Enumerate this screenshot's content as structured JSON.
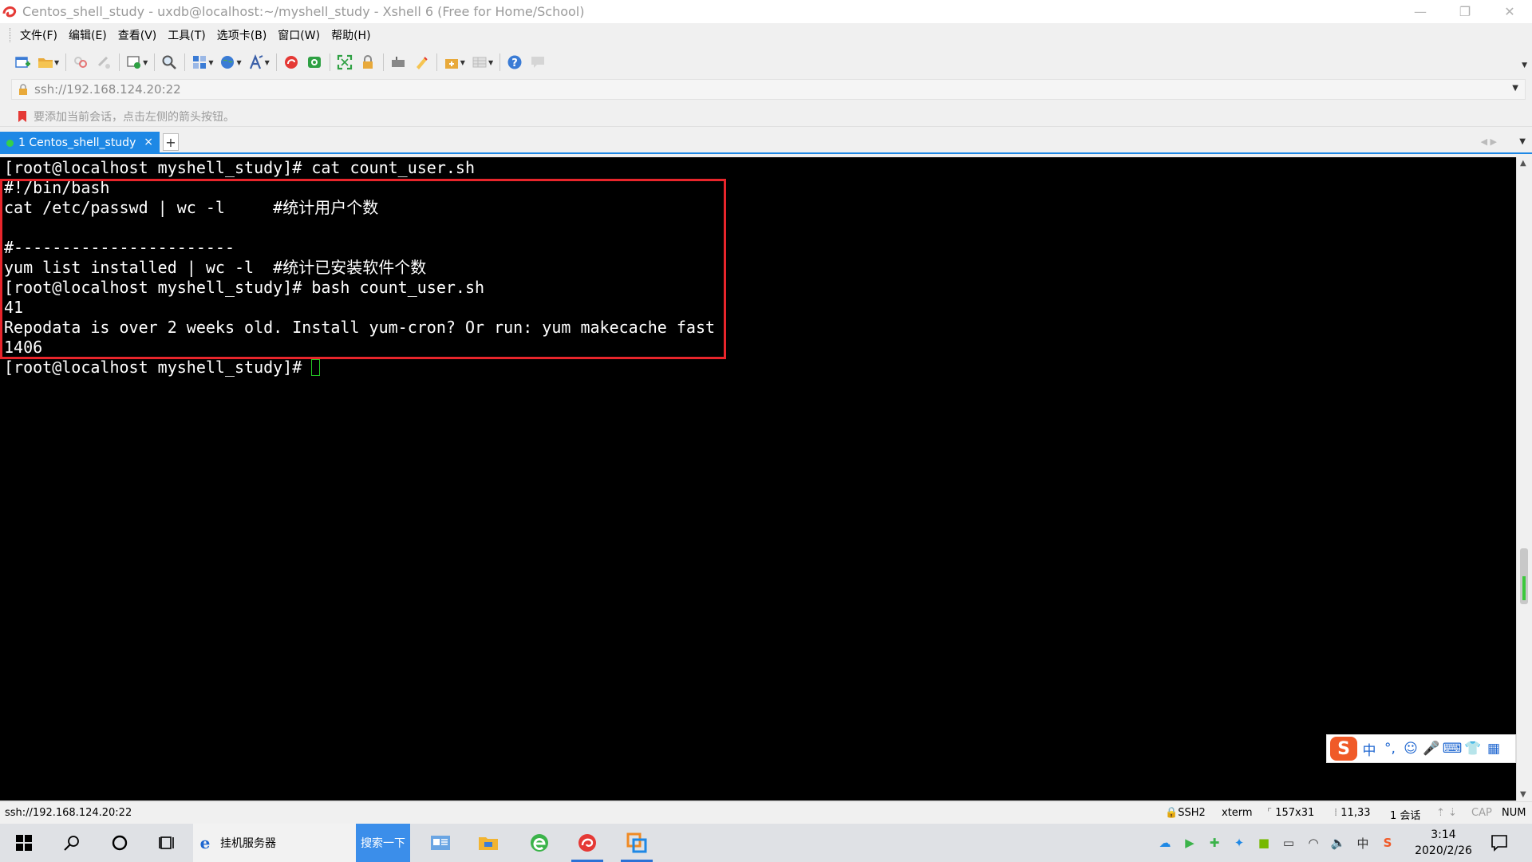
{
  "window": {
    "title": "Centos_shell_study - uxdb@localhost:~/myshell_study - Xshell 6 (Free for Home/School)",
    "minimize": "—",
    "restore": "❐",
    "close": "✕"
  },
  "menu": [
    "文件(F)",
    "编辑(E)",
    "查看(V)",
    "工具(T)",
    "选项卡(B)",
    "窗口(W)",
    "帮助(H)"
  ],
  "address": {
    "value": "ssh://192.168.124.20:22"
  },
  "hint": "要添加当前会话，点击左侧的箭头按钮。",
  "tabs": [
    {
      "label": "1 Centos_shell_study",
      "close": "×"
    }
  ],
  "terminal": {
    "lines": [
      "[root@localhost myshell_study]# cat count_user.sh",
      "#!/bin/bash",
      "cat /etc/passwd | wc -l     #统计用户个数",
      "",
      "#-----------------------",
      "yum list installed | wc -l  #统计已安装软件个数",
      "[root@localhost myshell_study]# bash count_user.sh",
      "41",
      "Repodata is over 2 weeks old. Install yum-cron? Or run: yum makecache fast",
      "1406",
      "[root@localhost myshell_study]# "
    ]
  },
  "ime": {
    "logo": "S",
    "items": [
      "中",
      "°,",
      "☺",
      "🎤",
      "⌨",
      "👕",
      "▦"
    ]
  },
  "status": {
    "address": "ssh://192.168.124.20:22",
    "protocol": "SSH2",
    "term": "xterm",
    "size": "157x31",
    "cursor_pos": "11,33",
    "sessions": "1 会话",
    "cap": "CAP",
    "num": "NUM"
  },
  "taskbar": {
    "search_text": "挂机服务器",
    "search_button": "搜索一下",
    "time": "3:14",
    "date": "2020/2/26",
    "ime_indicator": "中"
  },
  "colors": {
    "accent": "#1e88e5",
    "highlight_box": "#e8252b",
    "cursor": "#23c423"
  }
}
